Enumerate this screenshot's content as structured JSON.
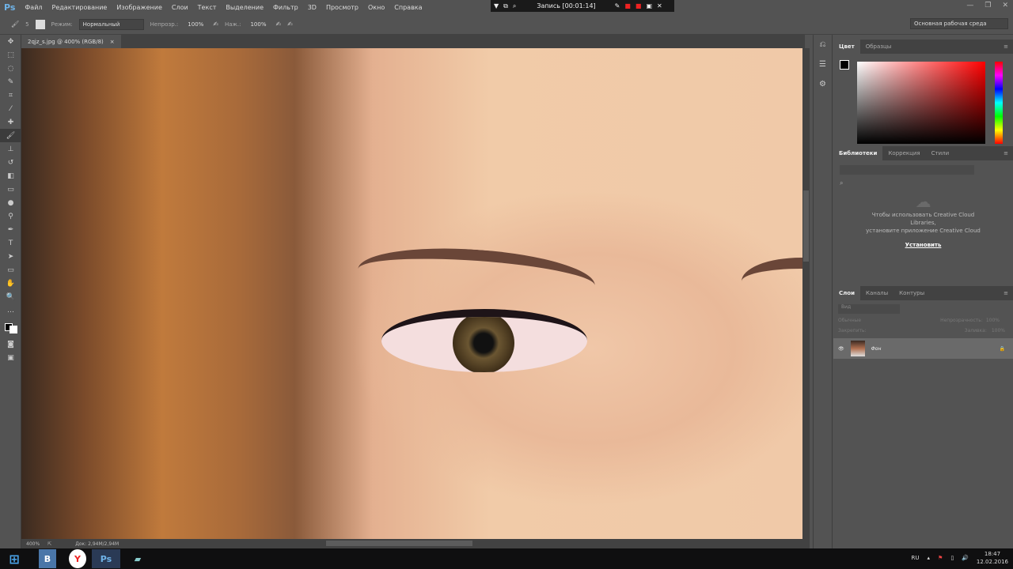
{
  "app": {
    "logo": "Ps"
  },
  "menu": [
    "Файл",
    "Редактирование",
    "Изображение",
    "Слои",
    "Текст",
    "Выделение",
    "Фильтр",
    "3D",
    "Просмотр",
    "Окно",
    "Справка"
  ],
  "recorder": {
    "label": "Запись [00:01:14]"
  },
  "options": {
    "brush_size": "5",
    "mode_label": "Режим:",
    "mode_value": "Нормальный",
    "opacity_label": "Непрозр.:",
    "opacity_value": "100%",
    "flow_label": "Наж.:",
    "flow_value": "100%",
    "workspace": "Основная рабочая среда"
  },
  "document": {
    "tab_title": "2qjz_s.jpg @ 400% (RGB/8)",
    "close": "×",
    "zoom": "400%",
    "doc_info": "Док: 2,94M/2,94M"
  },
  "color_panel": {
    "tabs": [
      "Цвет",
      "Образцы"
    ]
  },
  "libraries_panel": {
    "tabs": [
      "Библиотеки",
      "Коррекция",
      "Стили"
    ],
    "message_line1": "Чтобы использовать Creative Cloud",
    "message_line2": "Libraries,",
    "message_line3": "установите приложение Creative Cloud",
    "install": "Установить"
  },
  "layers_panel": {
    "tabs": [
      "Слои",
      "Каналы",
      "Контуры"
    ],
    "filter_placeholder": "Вид",
    "blend_mode": "Обычные",
    "opacity_label": "Непрозрачность:",
    "opacity_value": "100%",
    "lock_label": "Закрепить:",
    "fill_label": "Заливка:",
    "fill_value": "100%",
    "layers": [
      {
        "name": "Фон",
        "visible": true,
        "locked": true
      }
    ]
  },
  "taskbar": {
    "lang": "RU",
    "time": "18:47",
    "date": "12.02.2016"
  }
}
